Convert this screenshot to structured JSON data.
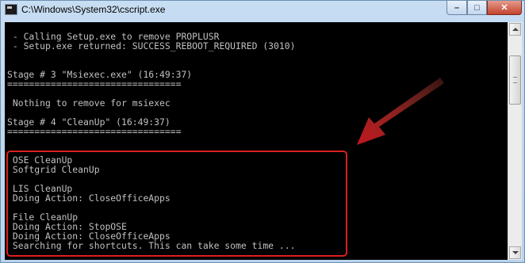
{
  "window": {
    "title": "C:\\Windows\\System32\\cscript.exe",
    "controls": {
      "minimize": "–",
      "maximize": "□",
      "close": "✕"
    }
  },
  "console": {
    "lines": [
      " - Calling Setup.exe to remove PROPLUSR",
      " - Setup.exe returned: SUCCESS_REBOOT_REQUIRED (3010)",
      "",
      "",
      "Stage # 3 \"Msiexec.exe\" (16:49:37)",
      "================================",
      "",
      " Nothing to remove for msiexec",
      "",
      "Stage # 4 \"CleanUp\" (16:49:37)",
      "================================",
      "",
      "",
      " OSE CleanUp",
      " Softgrid CleanUp",
      "",
      " LIS CleanUp",
      " Doing Action: CloseOfficeApps",
      "",
      " File CleanUp",
      " Doing Action: StopOSE",
      " Doing Action: CloseOfficeApps",
      " Searching for shortcuts. This can take some time ..."
    ]
  },
  "annotation": {
    "highlight_color": "#d8201f",
    "arrow_color": "#c0161c"
  },
  "icons": {
    "app": "console-window-icon",
    "arrow": "red-arrow-icon"
  }
}
